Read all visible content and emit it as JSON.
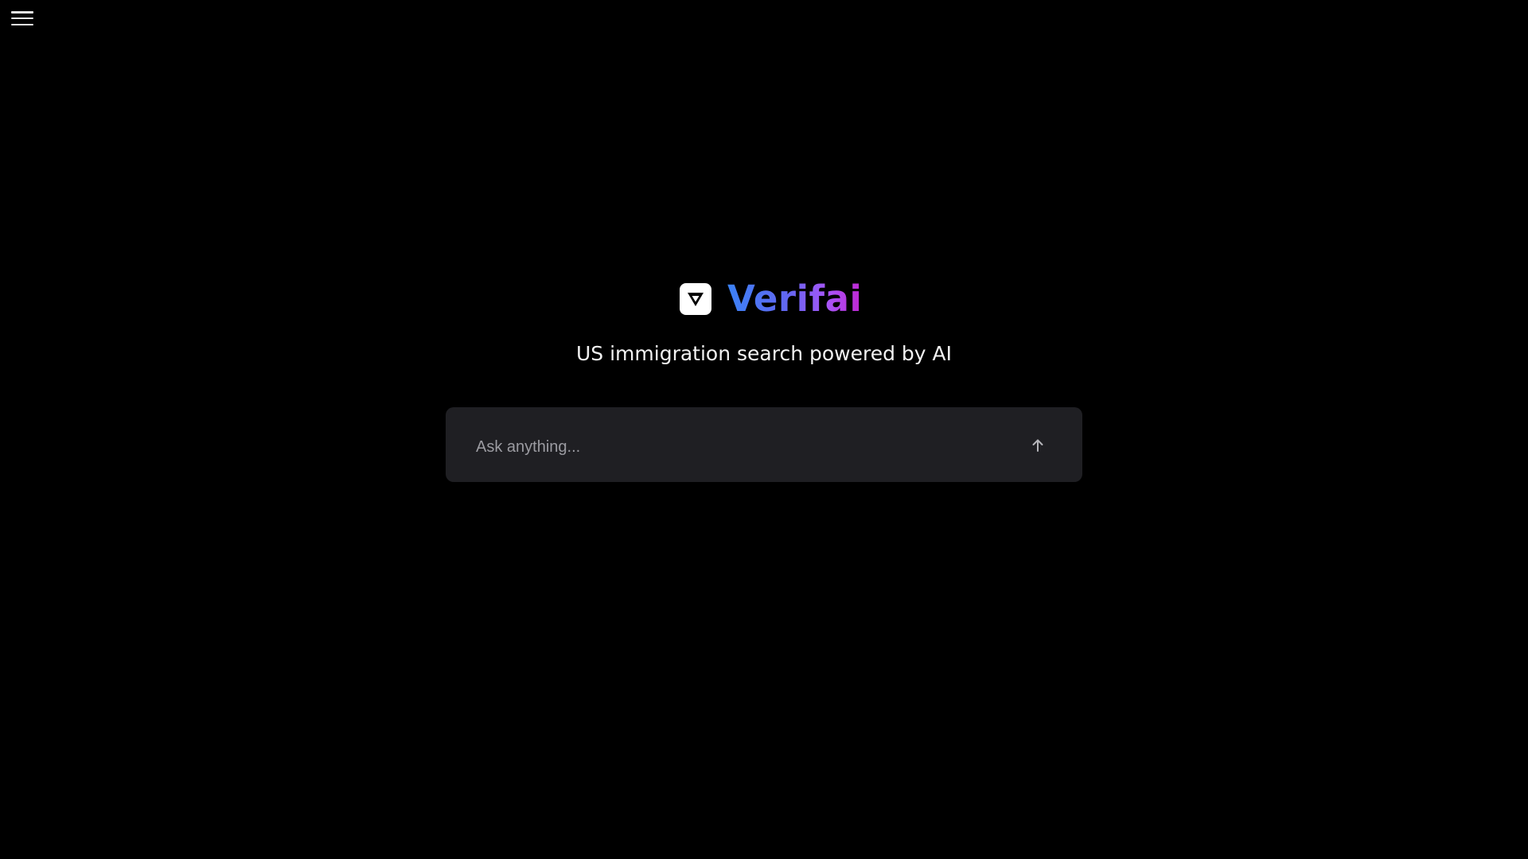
{
  "app": {
    "name": "Verifai",
    "tagline": "US immigration search powered by AI"
  },
  "header": {
    "menu_icon": "hamburger-menu-icon"
  },
  "search": {
    "placeholder": "Ask anything...",
    "value": "",
    "submit_icon": "arrow-up-icon"
  },
  "colors": {
    "background": "#000000",
    "search_box": "#1f1f23",
    "brand_gradient_start": "#3b82f6",
    "brand_gradient_end": "#c026d3",
    "text": "#f2f2f2",
    "placeholder": "#9b9ba1"
  }
}
